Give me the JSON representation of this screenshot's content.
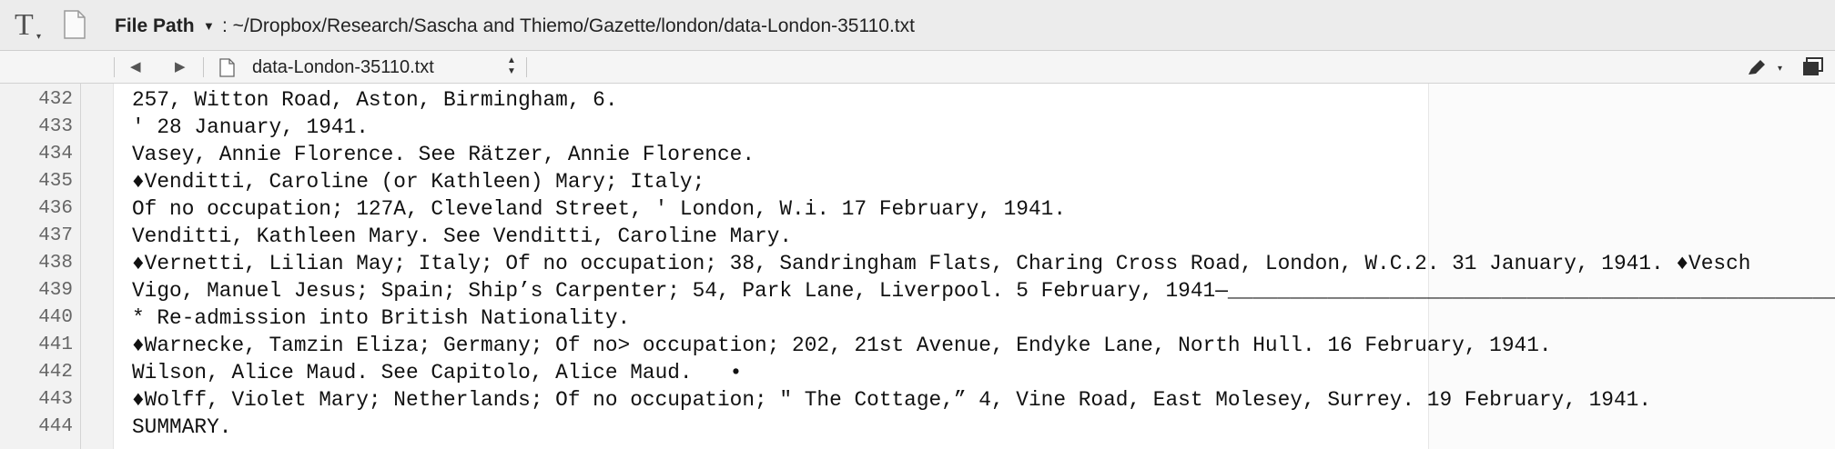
{
  "titlebar": {
    "path_label": "File Path",
    "path_value": ": ~/Dropbox/Research/Sascha and Thiemo/Gazette/london/data-London-35110.txt"
  },
  "navbar": {
    "back_icon": "triangle-left-icon",
    "forward_icon": "triangle-right-icon",
    "file_name": "data-London-35110.txt"
  },
  "editor": {
    "line_numbers": [
      "432",
      "433",
      "434",
      "435",
      "436",
      "437",
      "438",
      "439",
      "440",
      "441",
      "442",
      "443",
      "444"
    ],
    "lines": [
      "257, Witton Road, Aston, Birmingham, 6.",
      "' 28 January, 1941.",
      "Vasey, Annie Florence. See Rätzer, Annie Florence.",
      "♦Venditti, Caroline (or Kathleen) Mary; Italy;",
      "Of no occupation; 127A, Cleveland Street, ' London, W.i. 17 February, 1941.",
      "Venditti, Kathleen Mary. See Venditti, Caroline Mary.",
      "♦Vernetti, Lilian May; Italy; Of no occupation; 38, Sandringham Flats, Charing Cross Road, London, W.C.2. 31 January, 1941. ♦Vesch",
      "Vigo, Manuel Jesus; Spain; Ship’s Carpenter; 54, Park Lane, Liverpool. 5 February, 1941—_________________________________________________",
      "* Re-admission into British Nationality.",
      "♦Warnecke, Tamzin Eliza; Germany; Of no> occupation; 202, 21st Avenue, Endyke Lane, North Hull. 16 February, 1941.",
      "Wilson, Alice Maud. See Capitolo, Alice Maud.   •",
      "♦Wolff, Violet Mary; Netherlands; Of no occupation; \" The Cottage,” 4, Vine Road, East Molesey, Surrey. 19 February, 1941.",
      "SUMMARY."
    ]
  }
}
